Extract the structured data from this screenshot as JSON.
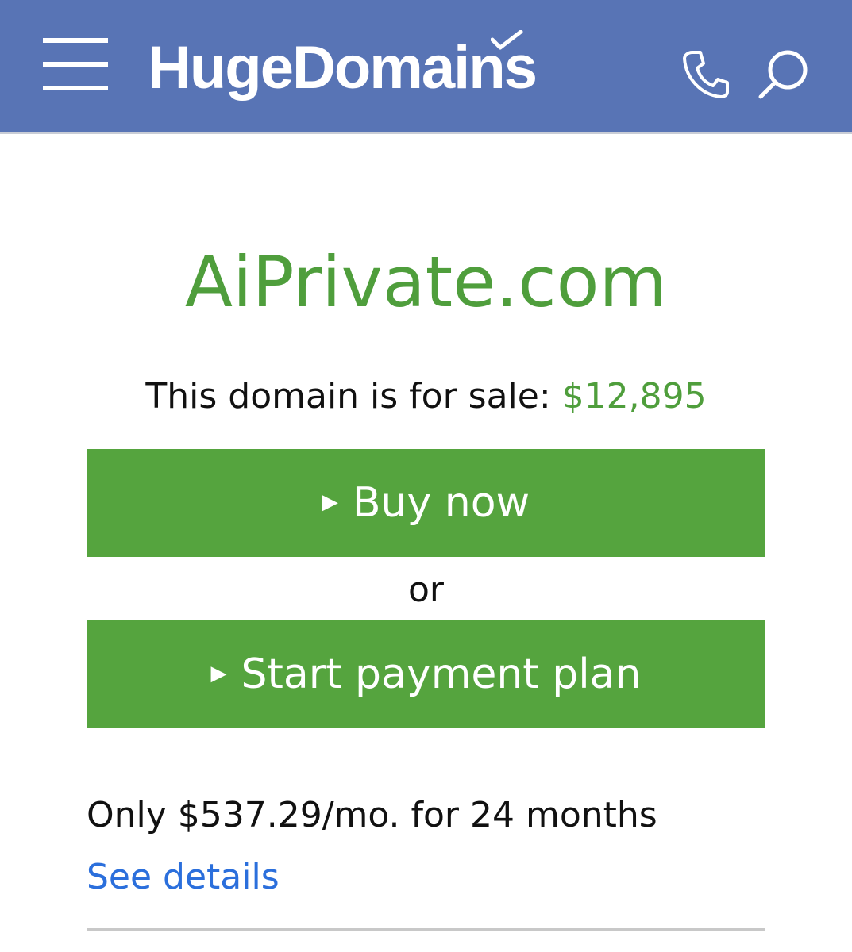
{
  "header": {
    "logo_text": "HugeDomains",
    "background_color": "#5874b5",
    "icons": [
      "menu-icon",
      "phone-icon",
      "search-icon"
    ]
  },
  "main": {
    "domain_name": "AiPrivate.com",
    "sale_label": "This domain is for sale:",
    "sale_price": "$12,895",
    "buy_now_label": "Buy now",
    "or_label": "or",
    "payment_plan_label": "Start payment plan",
    "plan_summary": "Only $537.29/mo. for 24 months",
    "see_details_label": "See details",
    "accent_color": "#55a43e",
    "link_color": "#2b6fdc"
  }
}
